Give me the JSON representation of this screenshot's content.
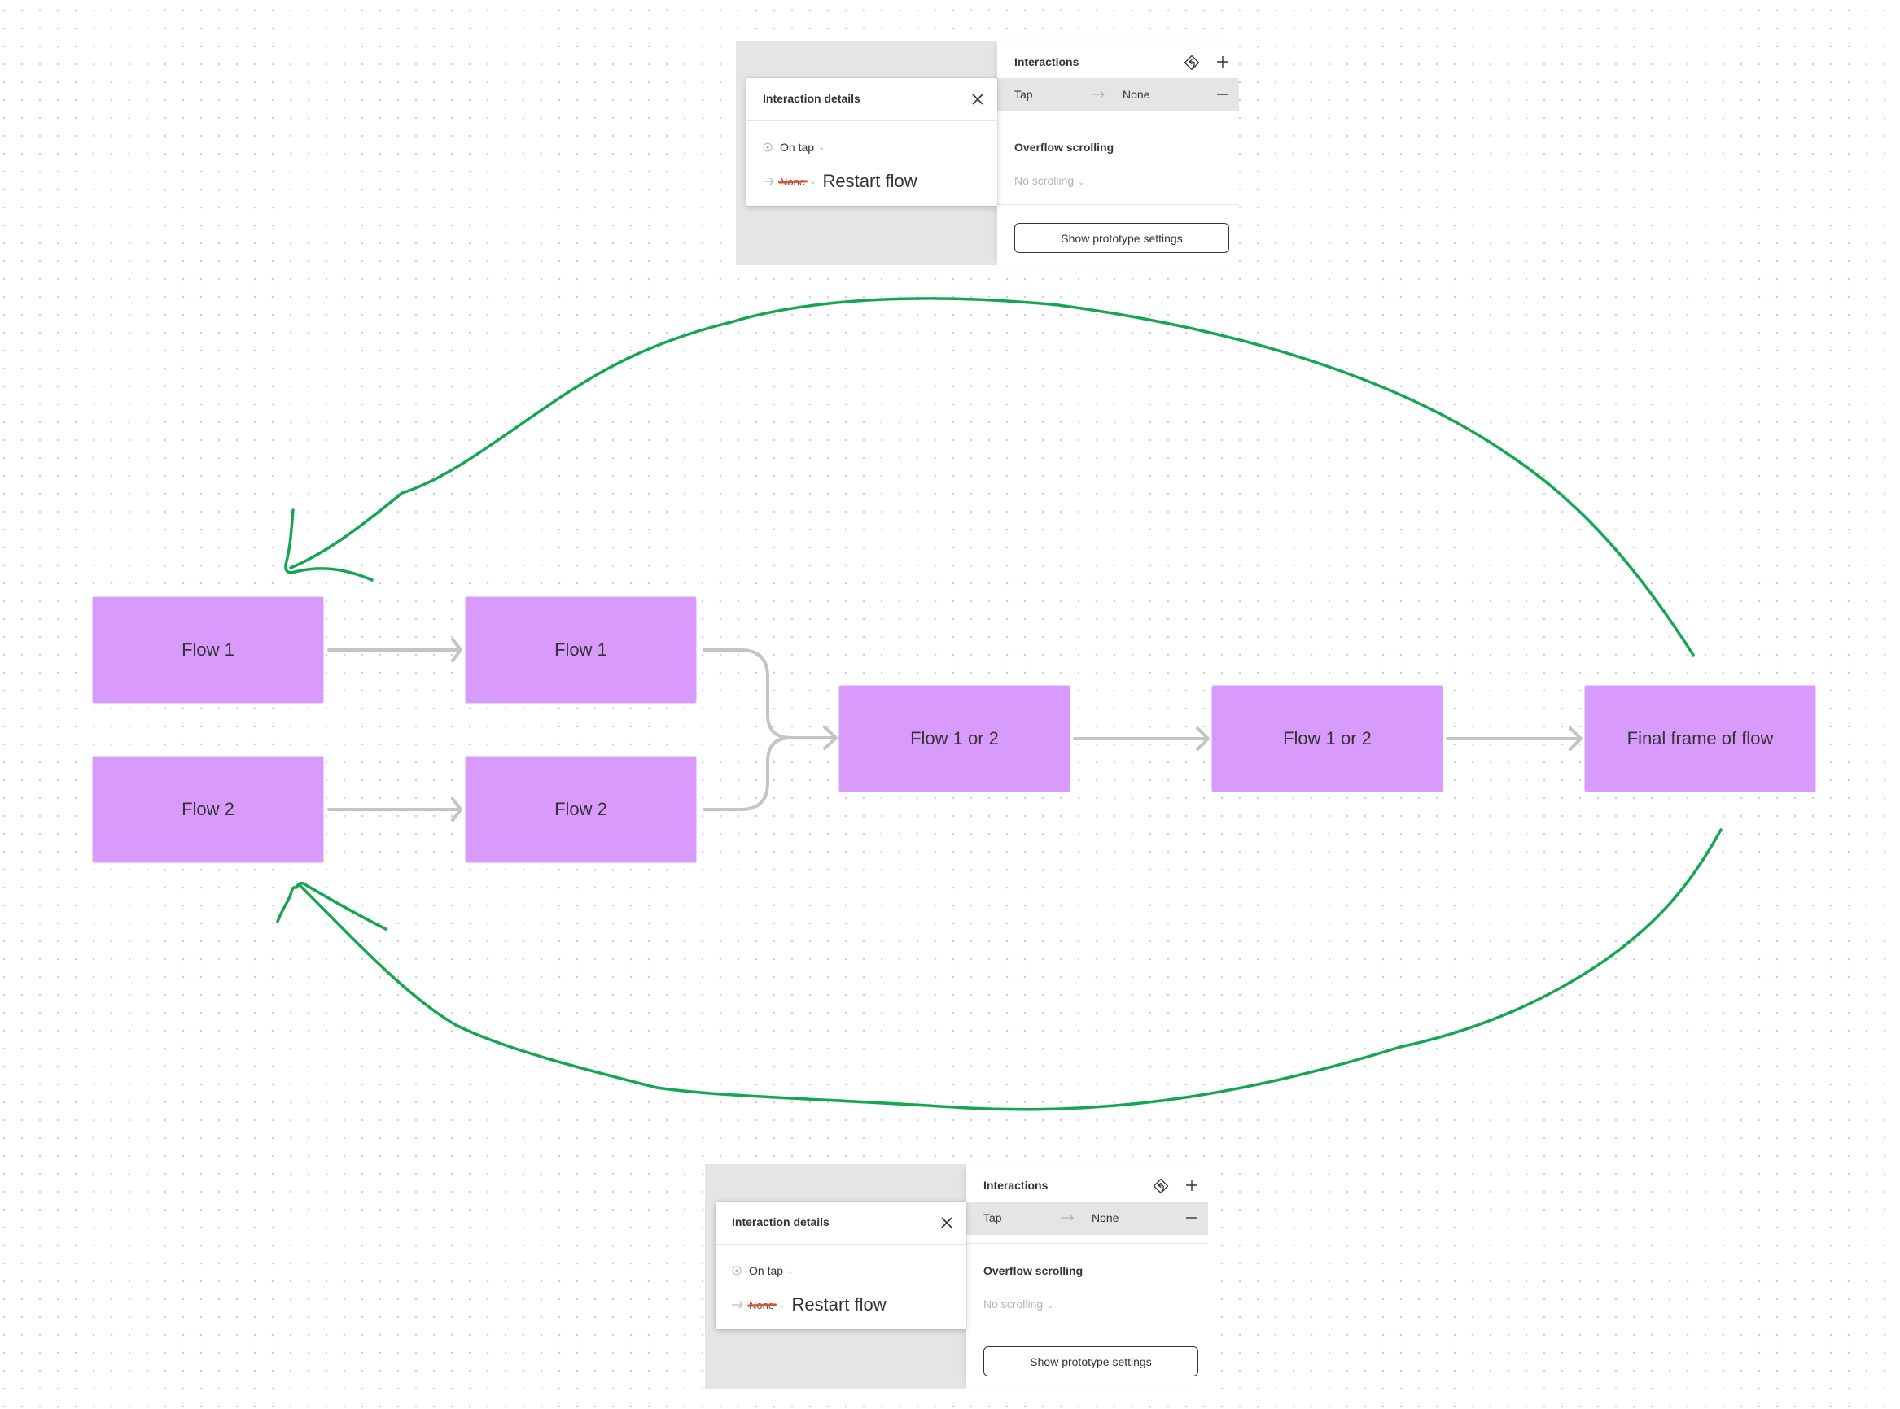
{
  "canvas": {
    "background": "#ffffff",
    "dot_color": "#cfcfcf"
  },
  "prototype_panels": [
    {
      "interaction_details": {
        "title": "Interaction details",
        "trigger": "On tap",
        "action_original": "None",
        "action_annotation": "Restart flow"
      },
      "interactions": {
        "title": "Interactions",
        "row": {
          "trigger": "Tap",
          "action": "None"
        }
      },
      "overflow": {
        "title": "Overflow scrolling",
        "value": "No scrolling"
      },
      "settings_button": "Show prototype settings"
    },
    {
      "interaction_details": {
        "title": "Interaction details",
        "trigger": "On tap",
        "action_original": "None",
        "action_annotation": "Restart flow"
      },
      "interactions": {
        "title": "Interactions",
        "row": {
          "trigger": "Tap",
          "action": "None"
        }
      },
      "overflow": {
        "title": "Overflow scrolling",
        "value": "No scrolling"
      },
      "settings_button": "Show prototype settings"
    }
  ],
  "flow": {
    "frame_color": "#d99bfb",
    "connector_color": "#c4c4c4",
    "annotation_color": "#14a650",
    "annotation_strike_color": "#e8501f",
    "frames": [
      {
        "id": "f1a",
        "label": "Flow 1"
      },
      {
        "id": "f1b",
        "label": "Flow 1"
      },
      {
        "id": "f2a",
        "label": "Flow 2"
      },
      {
        "id": "f2b",
        "label": "Flow 2"
      },
      {
        "id": "m1",
        "label": "Flow 1 or 2"
      },
      {
        "id": "m2",
        "label": "Flow 1 or 2"
      },
      {
        "id": "final",
        "label": "Final frame of flow"
      }
    ],
    "connections": [
      {
        "from": "f1a",
        "to": "f1b"
      },
      {
        "from": "f2a",
        "to": "f2b"
      },
      {
        "from": "f1b",
        "to": "m1"
      },
      {
        "from": "f2b",
        "to": "m1"
      },
      {
        "from": "m1",
        "to": "m2"
      },
      {
        "from": "m2",
        "to": "final"
      }
    ],
    "annotations": [
      {
        "from": "final",
        "to": "f1a",
        "kind": "hand-drawn-arrow"
      },
      {
        "from": "final",
        "to": "f2a",
        "kind": "hand-drawn-arrow"
      }
    ]
  }
}
